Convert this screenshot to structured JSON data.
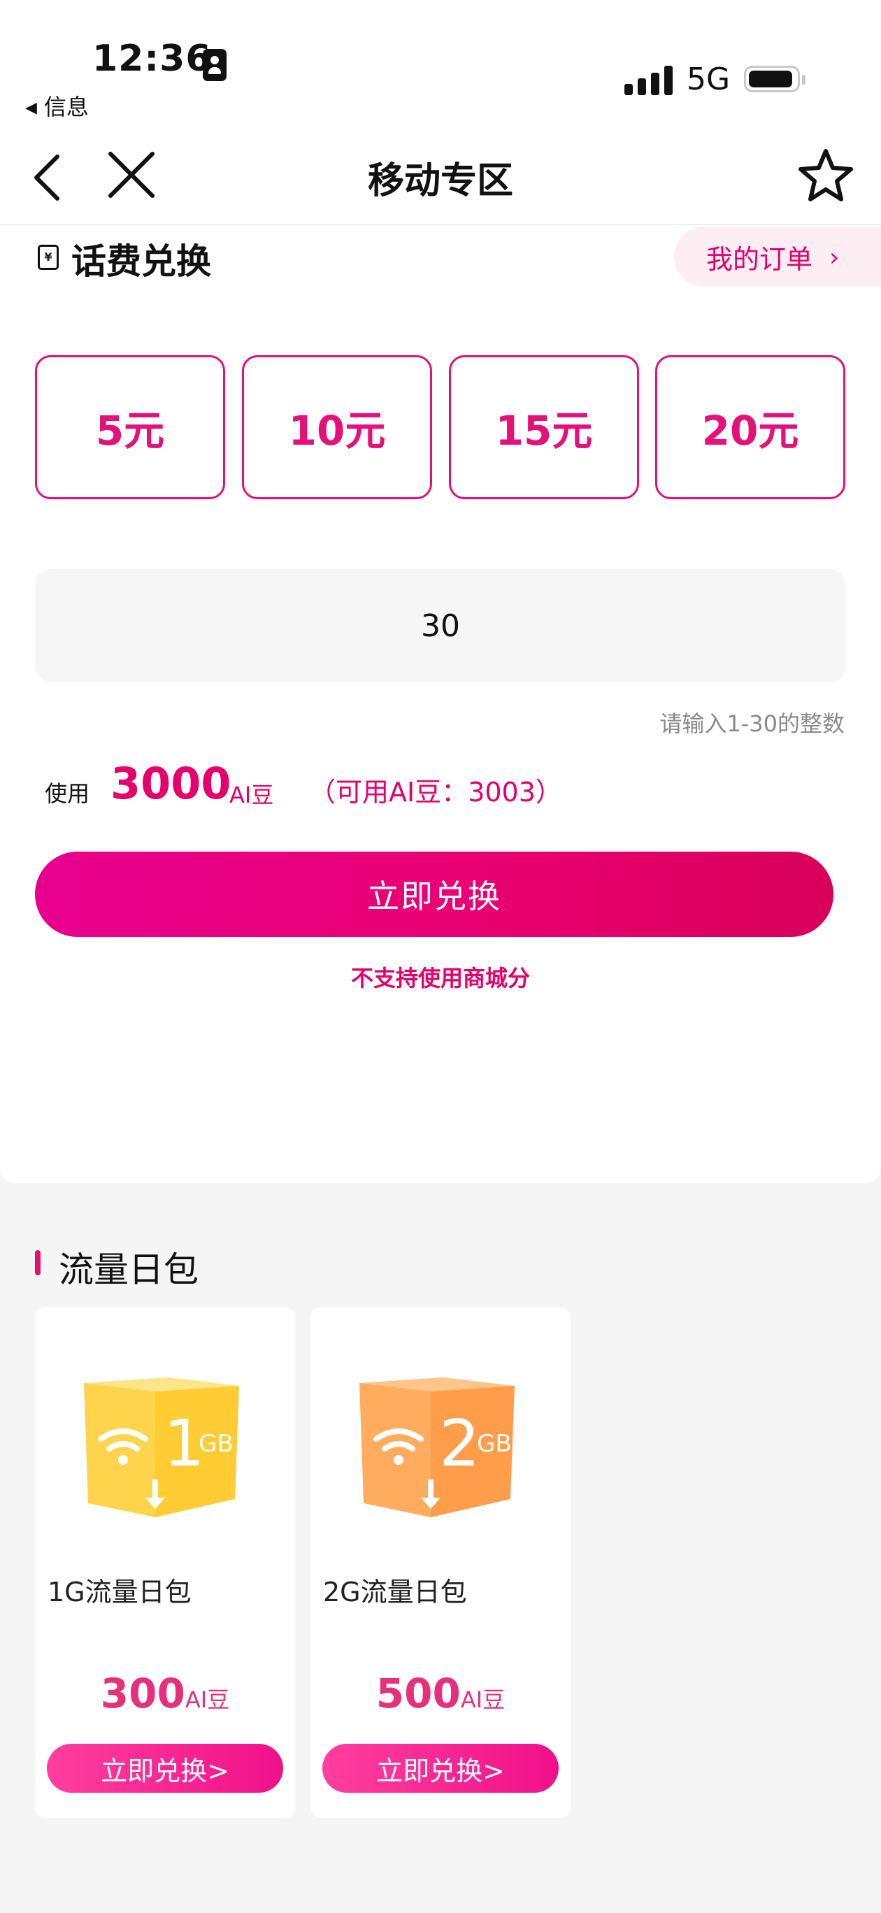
{
  "status_bar": {
    "time": "12:36",
    "back_app": "信息",
    "network": "5G"
  },
  "nav": {
    "title": "移动专区"
  },
  "bill_exchange": {
    "title": "话费兑换",
    "my_orders_label": "我的订单",
    "amount_options": [
      "5元",
      "10元",
      "15元",
      "20元"
    ],
    "input_value": "30",
    "input_hint": "请输入1-30的整数",
    "use_label": "使用",
    "use_amount": "3000",
    "use_unit": "AI豆",
    "available_text": "（可用AI豆：3003）",
    "exchange_button": "立即兑换",
    "no_points_note": "不支持使用商城分"
  },
  "data_packs": {
    "title": "流量日包",
    "items": [
      {
        "box_label": "1",
        "box_unit": "GB",
        "box_color": "#ffd25c",
        "name": "1G流量日包",
        "price": "300",
        "price_unit": "AI豆",
        "button": "立即兑换>"
      },
      {
        "box_label": "2",
        "box_unit": "GB",
        "box_color": "#ffa85c",
        "name": "2G流量日包",
        "price": "500",
        "price_unit": "AI豆",
        "button": "立即兑换>"
      }
    ]
  },
  "colors": {
    "accent": "#e5006b",
    "amount_border": "#e5107a"
  },
  "icons": [
    "contact-icon",
    "signal-icon",
    "battery-icon",
    "back-arrow-icon",
    "close-icon",
    "star-icon",
    "bill-icon",
    "chevron-right-icon",
    "wifi-icon",
    "download-arrow-icon"
  ]
}
